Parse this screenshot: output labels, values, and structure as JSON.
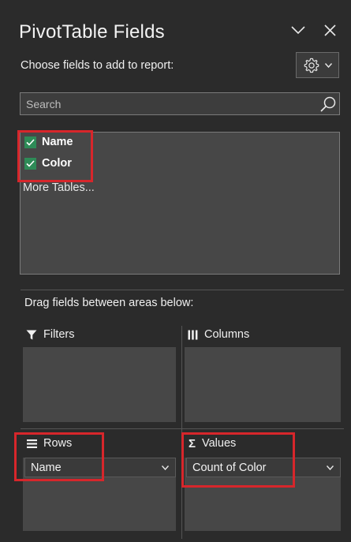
{
  "panel": {
    "title": "PivotTable Fields",
    "choose_label": "Choose fields to add to report:",
    "search_placeholder": "Search",
    "fields": [
      {
        "label": "Name",
        "checked": true
      },
      {
        "label": "Color",
        "checked": true
      }
    ],
    "more_tables": "More Tables...",
    "drag_label": "Drag fields between areas below:",
    "areas": {
      "filters": {
        "label": "Filters",
        "items": []
      },
      "columns": {
        "label": "Columns",
        "items": []
      },
      "rows": {
        "label": "Rows",
        "items": [
          "Name"
        ]
      },
      "values": {
        "label": "Values",
        "items": [
          "Count of Color"
        ]
      }
    }
  },
  "colors": {
    "background": "#2b2b2b",
    "box": "#474747",
    "check": "#2e8b57",
    "highlight": "#d7262b"
  }
}
